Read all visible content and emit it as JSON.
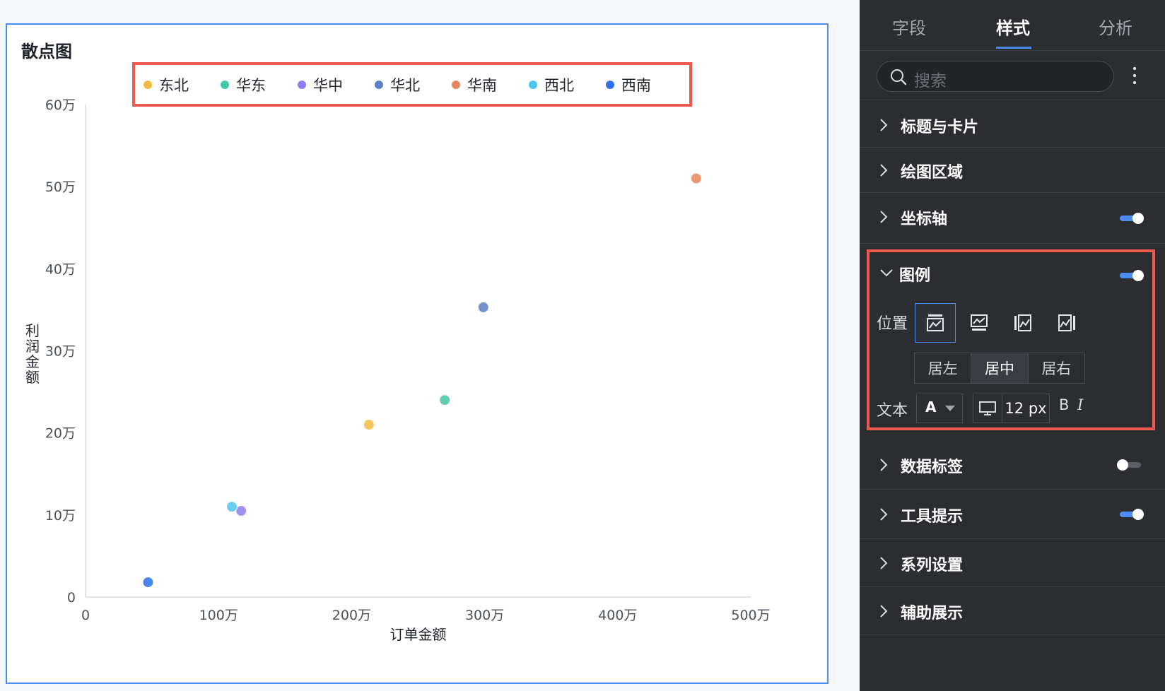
{
  "chart_card": {
    "title": "散点图"
  },
  "chart_data": {
    "type": "scatter",
    "xlabel": "订单金额",
    "ylabel": "利润金额",
    "xlim": [
      0,
      5000000
    ],
    "ylim": [
      0,
      600000
    ],
    "x_ticks": [
      "0",
      "100万",
      "200万",
      "300万",
      "400万",
      "500万"
    ],
    "y_ticks": [
      "0",
      "10万",
      "20万",
      "30万",
      "40万",
      "50万",
      "60万"
    ],
    "legend_position": "top-center",
    "grid": false,
    "series": [
      {
        "name": "东北",
        "color": "#f5b942",
        "points": [
          [
            2130000,
            210000
          ]
        ]
      },
      {
        "name": "华东",
        "color": "#45c9a8",
        "points": [
          [
            2700000,
            240000
          ]
        ]
      },
      {
        "name": "华中",
        "color": "#8f7cf0",
        "points": [
          [
            1170000,
            105000
          ]
        ]
      },
      {
        "name": "华北",
        "color": "#5b7fc4",
        "points": [
          [
            2990000,
            353000
          ]
        ]
      },
      {
        "name": "华南",
        "color": "#e8865a",
        "points": [
          [
            4590000,
            510000
          ]
        ]
      },
      {
        "name": "西北",
        "color": "#4cc6f0",
        "points": [
          [
            1100000,
            110000
          ]
        ]
      },
      {
        "name": "西南",
        "color": "#2f6ff0",
        "points": [
          [
            470000,
            18000
          ]
        ]
      }
    ]
  },
  "panel": {
    "tabs": [
      {
        "label": "字段"
      },
      {
        "label": "样式"
      },
      {
        "label": "分析"
      }
    ],
    "search_placeholder": "搜索",
    "sections": {
      "title_card": "标题与卡片",
      "plot_area": "绘图区域",
      "axis": "坐标轴",
      "legend": "图例",
      "data_label": "数据标签",
      "tooltip": "工具提示",
      "series_settings": "系列设置",
      "auxiliary": "辅助展示"
    },
    "legend_settings": {
      "position_label": "位置",
      "align_options": [
        "居左",
        "居中",
        "居右"
      ],
      "selected_align": "居中",
      "text_label": "文本",
      "font_color_glyph": "A",
      "font_size": "12 px",
      "bold": "B",
      "italic": "I"
    }
  }
}
